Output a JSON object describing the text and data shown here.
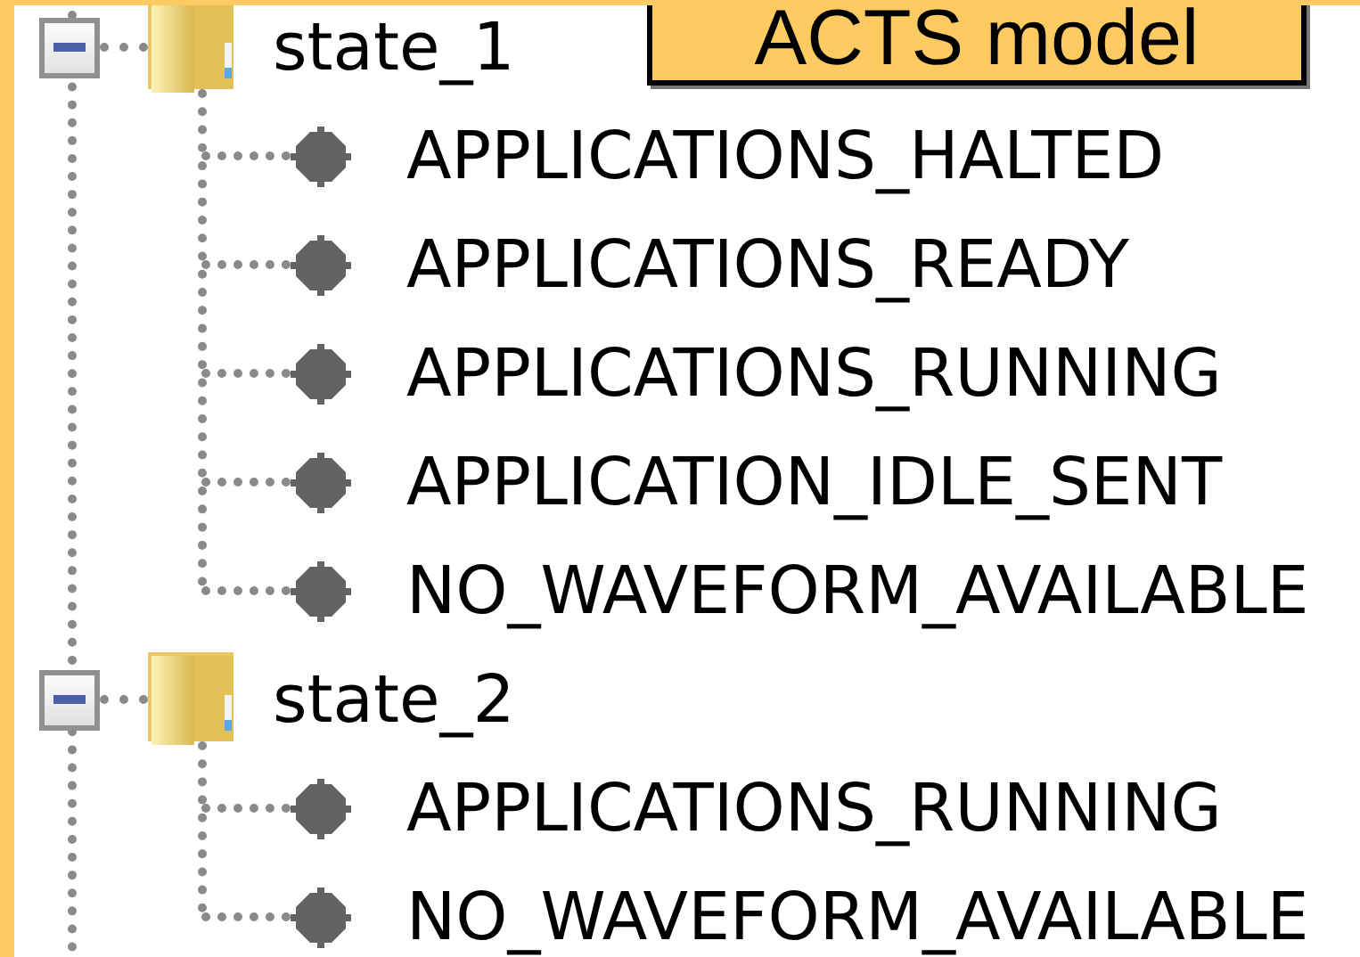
{
  "label": "ACTS model",
  "tree": [
    {
      "label": "state_1",
      "expanded": true,
      "children": [
        {
          "label": "APPLICATIONS_HALTED"
        },
        {
          "label": "APPLICATIONS_READY"
        },
        {
          "label": "APPLICATIONS_RUNNING"
        },
        {
          "label": "APPLICATION_IDLE_SENT"
        },
        {
          "label": "NO_WAVEFORM_AVAILABLE"
        }
      ]
    },
    {
      "label": "state_2",
      "expanded": true,
      "children": [
        {
          "label": "APPLICATIONS_RUNNING"
        },
        {
          "label": "NO_WAVEFORM_AVAILABLE"
        }
      ]
    }
  ]
}
